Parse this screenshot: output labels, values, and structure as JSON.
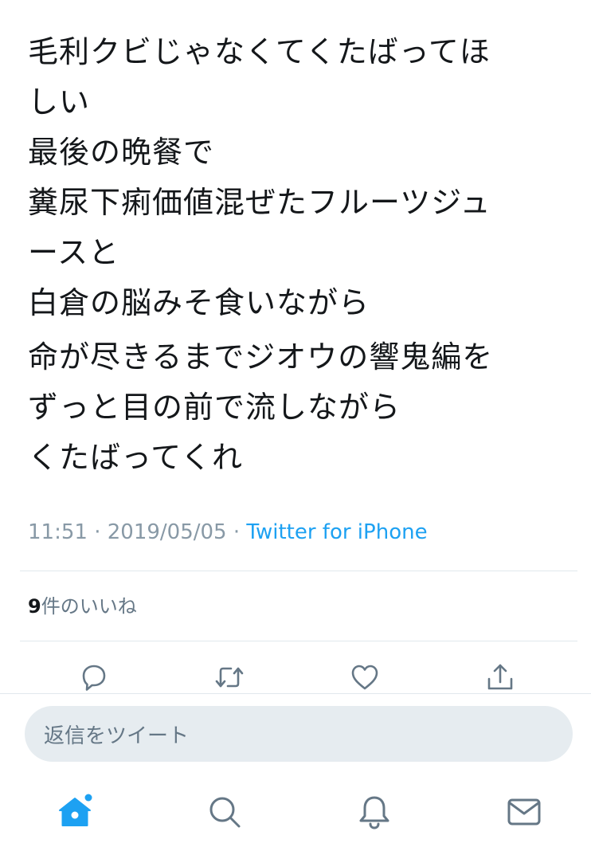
{
  "tweet": {
    "paragraphs": [
      "毛利クビじゃなくてくたばってほ\nしい\n最後の晩餐で\n糞尿下痢価値混ぜたフルーツジュ\nースと\n白倉の脳みそ食いながら",
      "命が尽きるまでジオウの響鬼編を\nずっと目の前で流しながら\nくたばってくれ"
    ],
    "time": "11:51",
    "separator": "·",
    "date": "2019/05/05",
    "source": "Twitter for iPhone"
  },
  "stats": {
    "like_count": "9",
    "like_label": "件のいいね"
  },
  "actions": [
    {
      "name": "reply-icon"
    },
    {
      "name": "retweet-icon"
    },
    {
      "name": "like-icon"
    },
    {
      "name": "share-icon"
    }
  ],
  "reply_bar": {
    "placeholder": "返信をツイート"
  },
  "tabs": [
    {
      "name": "home-icon",
      "active": true
    },
    {
      "name": "search-icon",
      "active": false
    },
    {
      "name": "notifications-icon",
      "active": false
    },
    {
      "name": "messages-icon",
      "active": false
    }
  ],
  "colors": {
    "accent": "#1da1f2",
    "icon_gray": "#657786",
    "divider": "#e1e8ed",
    "reply_bar_bg": "#e6ecf0"
  }
}
